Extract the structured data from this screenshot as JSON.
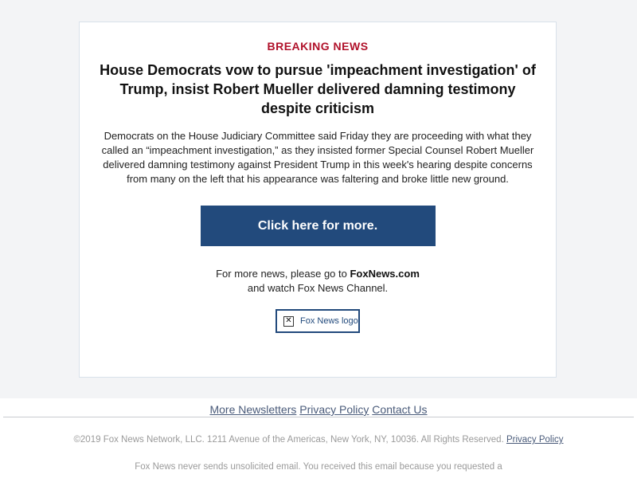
{
  "card": {
    "kicker": "BREAKING NEWS",
    "headline": "House Democrats vow to pursue 'impeachment investigation' of Trump, insist Robert Mueller delivered damning testimony despite criticism",
    "body": "Democrats on the House Judiciary Committee said Friday they are proceeding with what they called an “impeachment investigation,” as they insisted former Special Counsel Robert Mueller delivered damning testimony against President Trump in this week's hearing despite concerns from many on the left that his appearance was faltering and broke little new ground.",
    "cta_label": "Click here for more.",
    "more_prefix": "For more news, please go to ",
    "more_site": "FoxNews.com",
    "more_suffix": "and watch Fox News Channel.",
    "logo_alt": "Fox News logo"
  },
  "footer": {
    "links": [
      "More Newsletters",
      "Privacy Policy",
      "Contact Us"
    ],
    "copyright": "©2019 Fox News Network, LLC. 1211 Avenue of the Americas, New York, NY, 10036. All Rights Reserved.",
    "copyright_link": "Privacy Policy",
    "unsolicited": "Fox News never sends unsolicited email. You received this email because you requested a"
  },
  "colors": {
    "accent_red": "#b0112a",
    "button_blue": "#224a7c"
  },
  "icons": {
    "logo": "broken-image-icon"
  }
}
